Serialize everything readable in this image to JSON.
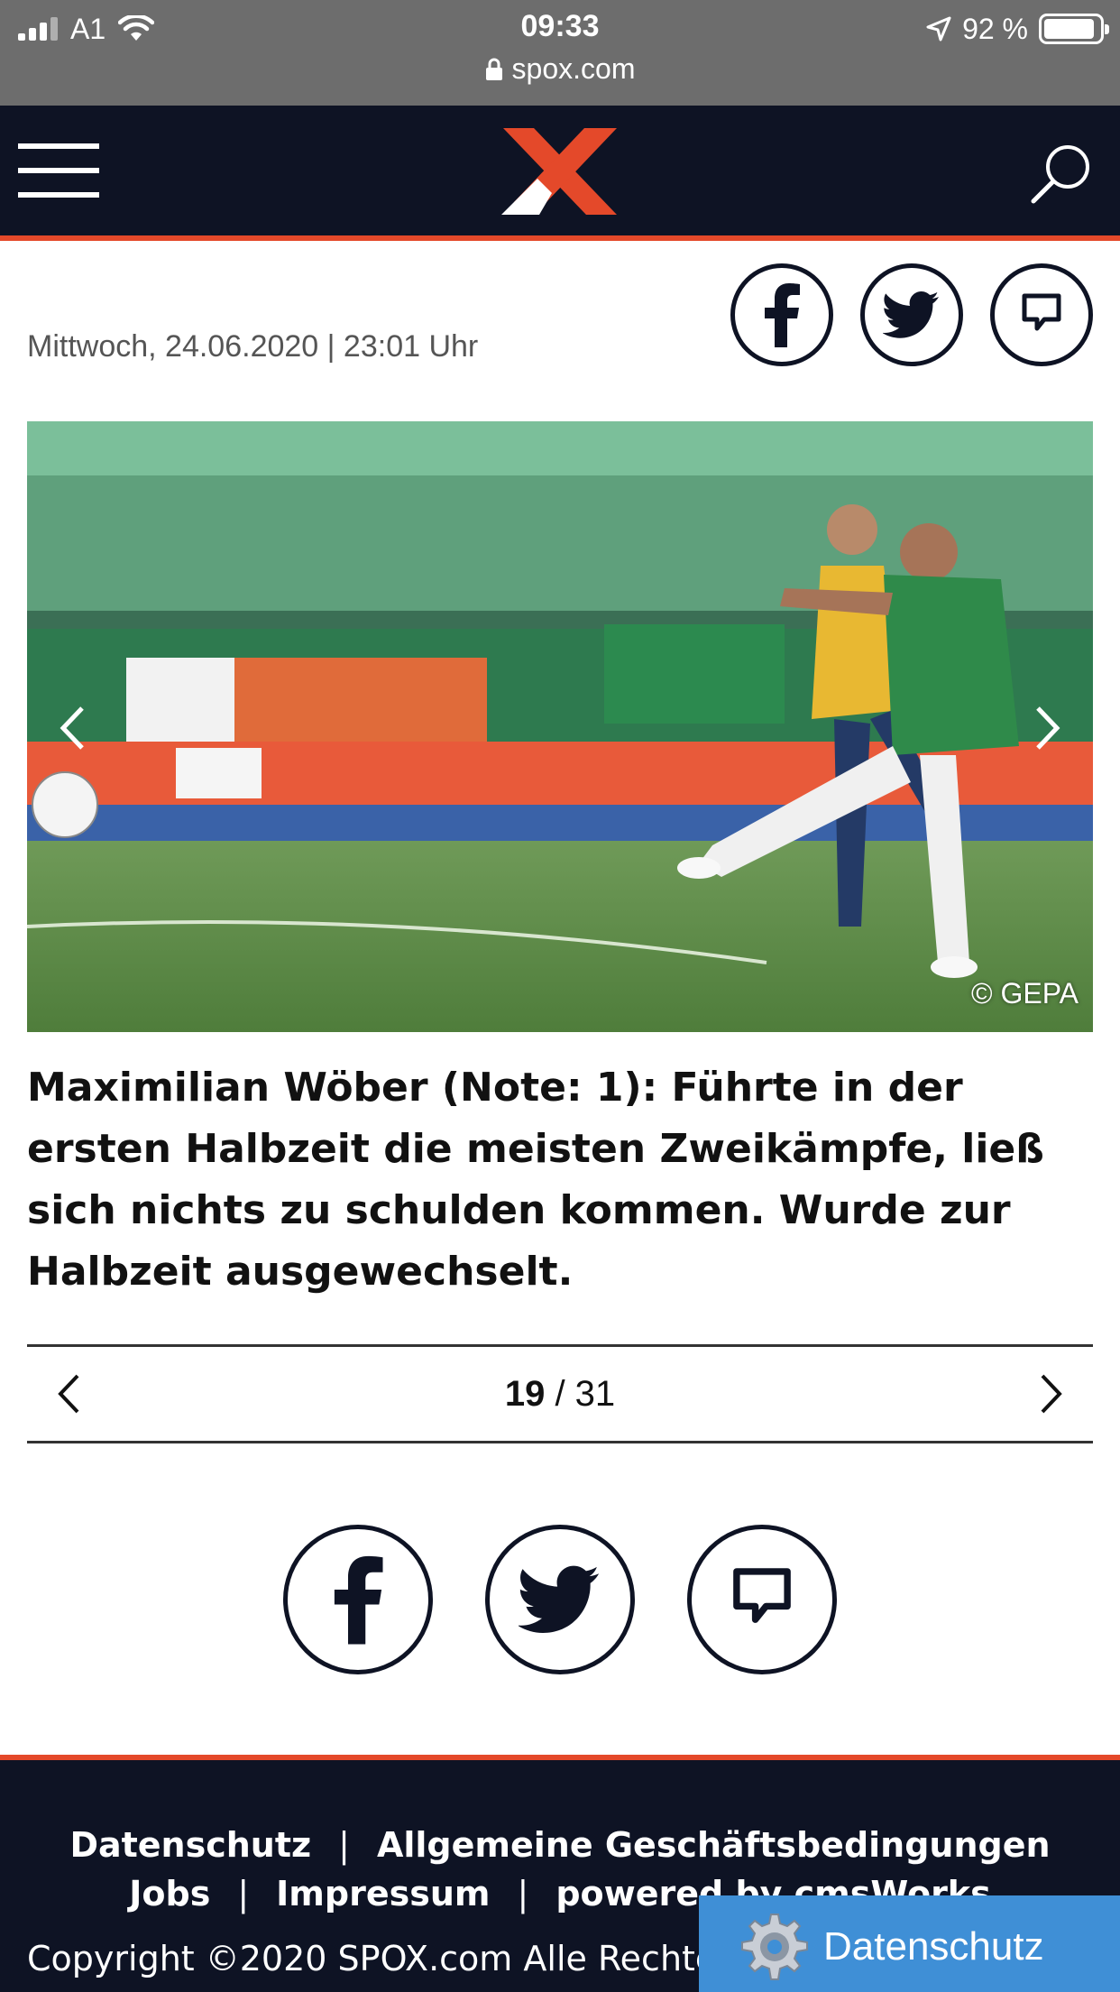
{
  "status_bar": {
    "carrier": "A1",
    "time": "09:33",
    "battery": "92 %",
    "battery_level": 0.92,
    "url": "spox.com"
  },
  "header": {
    "menu_icon": "hamburger-menu-icon",
    "logo": "spox-x-logo",
    "search_icon": "search-icon"
  },
  "article": {
    "date": "Mittwoch, 24.06.2020 | 23:01 Uhr",
    "photo_credit": "© GEPA",
    "caption": "Maximilian Wöber (Note: 1): Führte in der ersten Halbzeit die meisten Zweikämpfe, ließ sich nichts zu schulden kommen. Wurde zur Halbzeit ausgewechselt."
  },
  "pager": {
    "current": "19",
    "separator": " / ",
    "total": "31"
  },
  "footer": {
    "links_row1": [
      "Datenschutz",
      "Allgemeine Geschäftsbedingungen"
    ],
    "links_row2": [
      "Jobs",
      "Impressum",
      "powered by cmsWorks"
    ],
    "separator": "|",
    "copyright": "Copyright ©2020 SPOX.com Alle Rechte",
    "privacy_button": "Datenschutz"
  },
  "colors": {
    "header_bg": "#0e1324",
    "accent": "#e4492a",
    "privacy_button_bg": "#3f8fd6"
  }
}
